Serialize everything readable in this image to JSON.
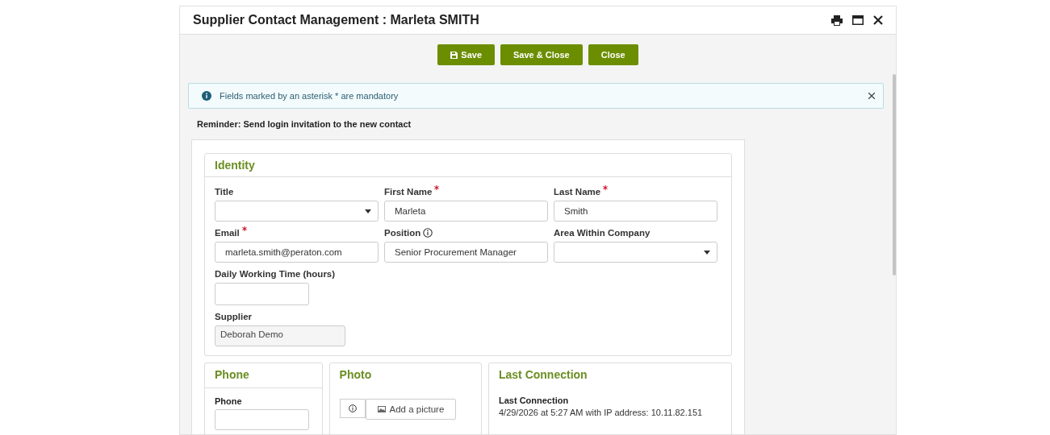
{
  "window": {
    "title": "Supplier Contact Management : Marleta SMITH"
  },
  "toolbar": [
    {
      "label": "Save",
      "kind": "save"
    },
    {
      "label": "Save & Close",
      "kind": "plain"
    },
    {
      "label": "Close",
      "kind": "plain"
    }
  ],
  "alert": {
    "text": "Fields marked by an asterisk * are mandatory"
  },
  "reminder": "Reminder: Send login invitation to the new contact",
  "identity": {
    "title": "Identity",
    "fields": [
      {
        "label": "Title",
        "kind": "select",
        "required": false,
        "info": false
      },
      {
        "label": "First Name",
        "kind": "text",
        "value": "Marleta",
        "required": true,
        "info": false
      },
      {
        "label": "Last Name",
        "kind": "text",
        "value": "Smith",
        "required": true,
        "info": false
      },
      {
        "label": "Email",
        "kind": "text",
        "value": "marleta.smith@peraton.com",
        "required": true,
        "info": false
      },
      {
        "label": "Position",
        "kind": "text",
        "value": "Senior Procurement Manager",
        "required": false,
        "info": true
      },
      {
        "label": "Area Within Company",
        "kind": "select",
        "required": false,
        "info": false
      },
      {
        "label": "Daily Working Time (hours)",
        "kind": "short",
        "required": false,
        "info": false
      },
      {
        "label": "Supplier",
        "kind": "readonly",
        "value": "Deborah Demo",
        "required": false,
        "info": false
      }
    ]
  },
  "phone": {
    "title": "Phone",
    "label": "Phone"
  },
  "photo": {
    "title": "Photo",
    "button": "Add a picture"
  },
  "last_connection": {
    "title": "Last Connection",
    "label": "Last Connection",
    "text": "4/29/2026 at 5:27 AM with IP address: 10.11.82.151"
  }
}
